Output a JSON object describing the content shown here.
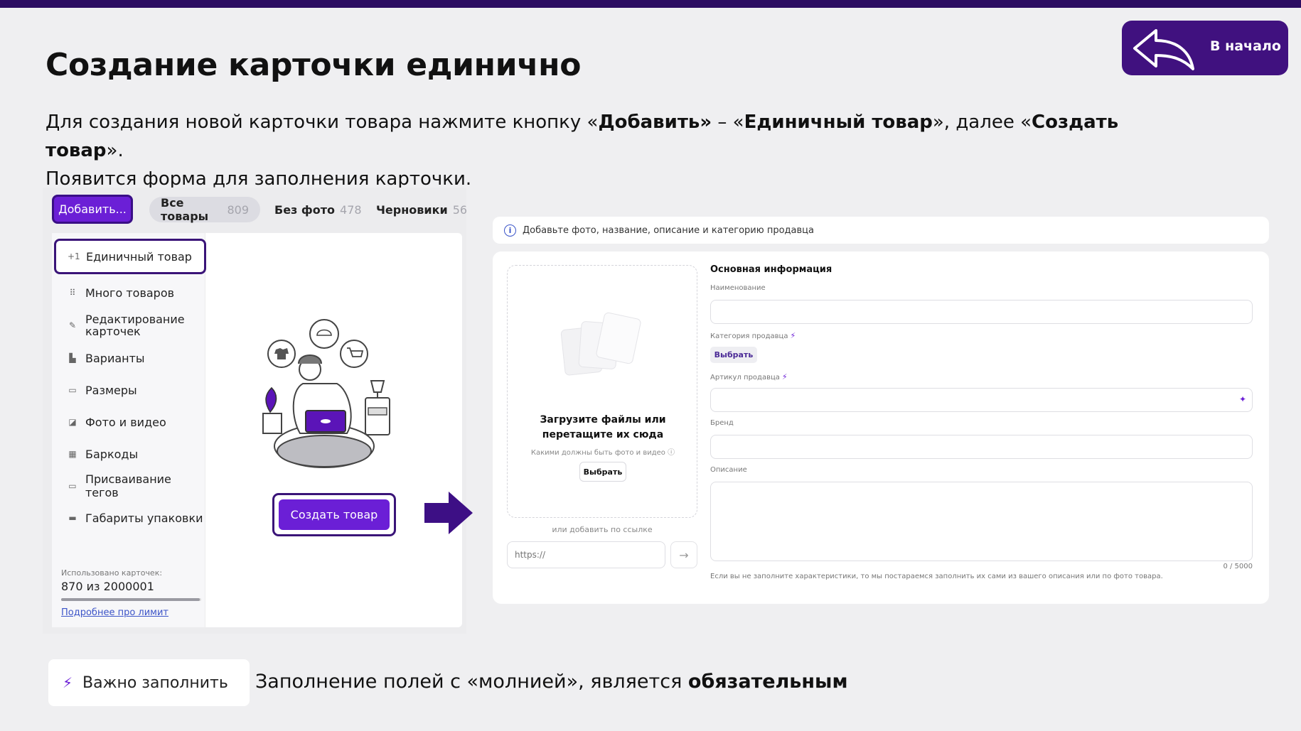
{
  "slide": {
    "title": "Создание карточки единично",
    "intro": {
      "p1": "Для создания новой карточки товара нажмите кнопку «",
      "b1": "Добавить»",
      "p2": " – «",
      "b2": "Единичный товар",
      "p3": "», далее «",
      "b3": "Создать товар",
      "p4": "».",
      "line2": "Появится форма для заполнения карточки."
    },
    "back_label": "В начало"
  },
  "left_screen": {
    "add_button": "Добавить...",
    "tabs": [
      {
        "label": "Все товары",
        "count": "809"
      },
      {
        "label": "Без фото",
        "count": "478"
      },
      {
        "label": "Черновики",
        "count": "56"
      }
    ],
    "menu": [
      {
        "icon": "+1",
        "label": "Единичный товар"
      },
      {
        "icon": "grid-icon",
        "label": "Много товаров"
      },
      {
        "icon": "pencil-icon",
        "label": "Редактирование карточек"
      },
      {
        "icon": "variants-icon",
        "label": "Варианты"
      },
      {
        "icon": "ruler-icon",
        "label": "Размеры"
      },
      {
        "icon": "image-icon",
        "label": "Фото и видео"
      },
      {
        "icon": "barcode-icon",
        "label": "Баркоды"
      },
      {
        "icon": "tag-icon",
        "label": "Присваивание тегов"
      },
      {
        "icon": "box-ruler-icon",
        "label": "Габариты упаковки"
      }
    ],
    "limit": {
      "label": "Использовано карточек:",
      "value": "870 из 2000001",
      "fraction": 0.99,
      "link": "Подробнее про лимит"
    },
    "create_button": "Создать товар"
  },
  "right_screen": {
    "hint": "Добавьте фото, название, описание и категорию продавца",
    "upload": {
      "title": "Загрузите файлы или перетащите их сюда",
      "subtitle": "Какими должны быть фото и видео",
      "button": "Выбрать",
      "url_label": "или добавить по ссылке",
      "url_placeholder": "https://"
    },
    "section_title": "Основная информация",
    "fields": {
      "name_label": "Наименование",
      "category_label": "Категория продавца",
      "category_button": "Выбрать",
      "article_label": "Артикул продавца",
      "brand_label": "Бренд",
      "description_label": "Описание",
      "counter": "0 / 5000"
    },
    "note": "Если вы не заполните характеристики, то мы постараемся заполнить их сами из вашего описания или по фото товара."
  },
  "bottom": {
    "important_label": "Важно заполнить",
    "text_plain": "Заполнение полей с «молнией», является ",
    "text_bold": "обязательным"
  },
  "colors": {
    "accent": "#6b1fd6",
    "dark_purple": "#40117f",
    "outline": "#3a1478"
  }
}
